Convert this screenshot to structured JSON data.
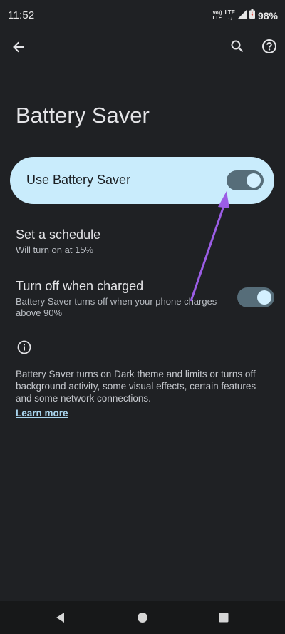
{
  "status_bar": {
    "time": "11:52",
    "volte_label": "Vo)) LTE",
    "lte_label": "LTE",
    "battery_percent": "98%"
  },
  "app_bar": {
    "back_icon": "arrow-back-icon",
    "search_icon": "search-icon",
    "help_icon": "help-icon"
  },
  "page": {
    "title": "Battery Saver"
  },
  "main_toggle": {
    "label": "Use Battery Saver",
    "enabled": true
  },
  "schedule": {
    "title": "Set a schedule",
    "subtitle": "Will turn on at 15%"
  },
  "turn_off_charged": {
    "title": "Turn off when charged",
    "subtitle": "Battery Saver turns off when your phone charges above 90%",
    "enabled": true
  },
  "info": {
    "icon": "info-icon",
    "text": "Battery Saver turns on Dark theme and limits or turns off background activity, some visual effects, certain features and some network connections.",
    "learn_more": "Learn more"
  },
  "colors": {
    "background": "#1f2124",
    "card": "#c9ecfc",
    "switch_track": "#566d79",
    "switch_knob": "#d3f0ff",
    "link": "#a9d5ee",
    "annotation_arrow": "#9b5de5"
  }
}
